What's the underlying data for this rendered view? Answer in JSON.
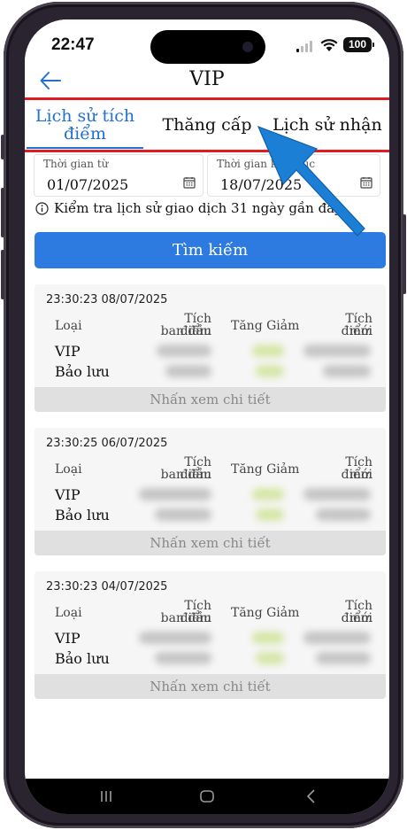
{
  "status_bar": {
    "time": "22:47",
    "battery": "100"
  },
  "header": {
    "title": "VIP"
  },
  "tabs": [
    {
      "label": "Lịch sử tích điểm",
      "active": true
    },
    {
      "label": "Thăng cấp",
      "active": false
    },
    {
      "label": "Lịch sử nhận",
      "active": false
    }
  ],
  "filters": {
    "from_label": "Thời gian từ",
    "from_value": "01/07/2025",
    "to_label": "Thời gian kết thúc",
    "to_value": "18/07/2025"
  },
  "hint": "Kiểm tra lịch sử giao dịch 31 ngày gần đây",
  "search_button": "Tìm kiếm",
  "columns": {
    "type": "Loại",
    "initial_1": "Tích điểm",
    "initial_2": "ban đầu",
    "change": "Tăng Giảm",
    "new_1": "Tích điểm",
    "new_2": "mới"
  },
  "records": [
    {
      "timestamp": "23:30:23 08/07/2025",
      "row1": "VIP",
      "row2": "Bảo lưu",
      "detail": "Nhấn xem chi tiết"
    },
    {
      "timestamp": "23:30:25 06/07/2025",
      "row1": "VIP",
      "row2": "Bảo lưu",
      "detail": "Nhấn xem chi tiết"
    },
    {
      "timestamp": "23:30:23 04/07/2025",
      "row1": "VIP",
      "row2": "Bảo lưu",
      "detail": "Nhấn xem chi tiết"
    }
  ],
  "colors": {
    "accent": "#2d7be0",
    "tab_active": "#2170d4",
    "highlight": "#e11b22",
    "arrow": "#1c7fd6"
  }
}
